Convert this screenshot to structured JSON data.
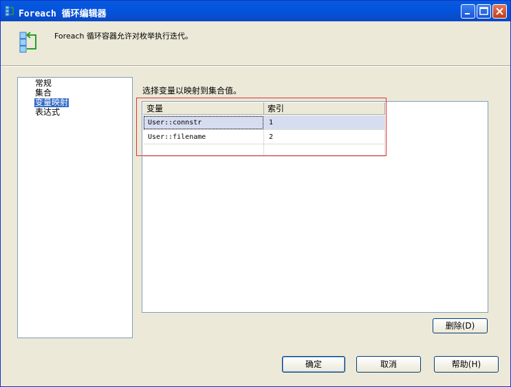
{
  "window": {
    "title": "Foreach 循环编辑器",
    "icon": "foreach-container-icon"
  },
  "header": {
    "description": "Foreach 循环容器允许对枚举执行迭代。",
    "icon": "foreach-loop-icon"
  },
  "nav": {
    "items": [
      {
        "label": "常规",
        "selected": false
      },
      {
        "label": "集合",
        "selected": false
      },
      {
        "label": "变量映射",
        "selected": true
      },
      {
        "label": "表达式",
        "selected": false
      }
    ]
  },
  "main": {
    "grid_label": "选择变量以映射到集合值。",
    "columns": [
      "变量",
      "索引"
    ],
    "rows": [
      {
        "variable": "User::connstr",
        "index": "1"
      },
      {
        "variable": "User::filename",
        "index": "2"
      }
    ],
    "delete_button": "删除(D)"
  },
  "footer": {
    "ok_label": "确定",
    "cancel_label": "取消",
    "help_label": "帮助(H)"
  },
  "colors": {
    "titlebar": "#0054e3",
    "selection": "#316ac5",
    "highlight_box": "#e03030"
  }
}
